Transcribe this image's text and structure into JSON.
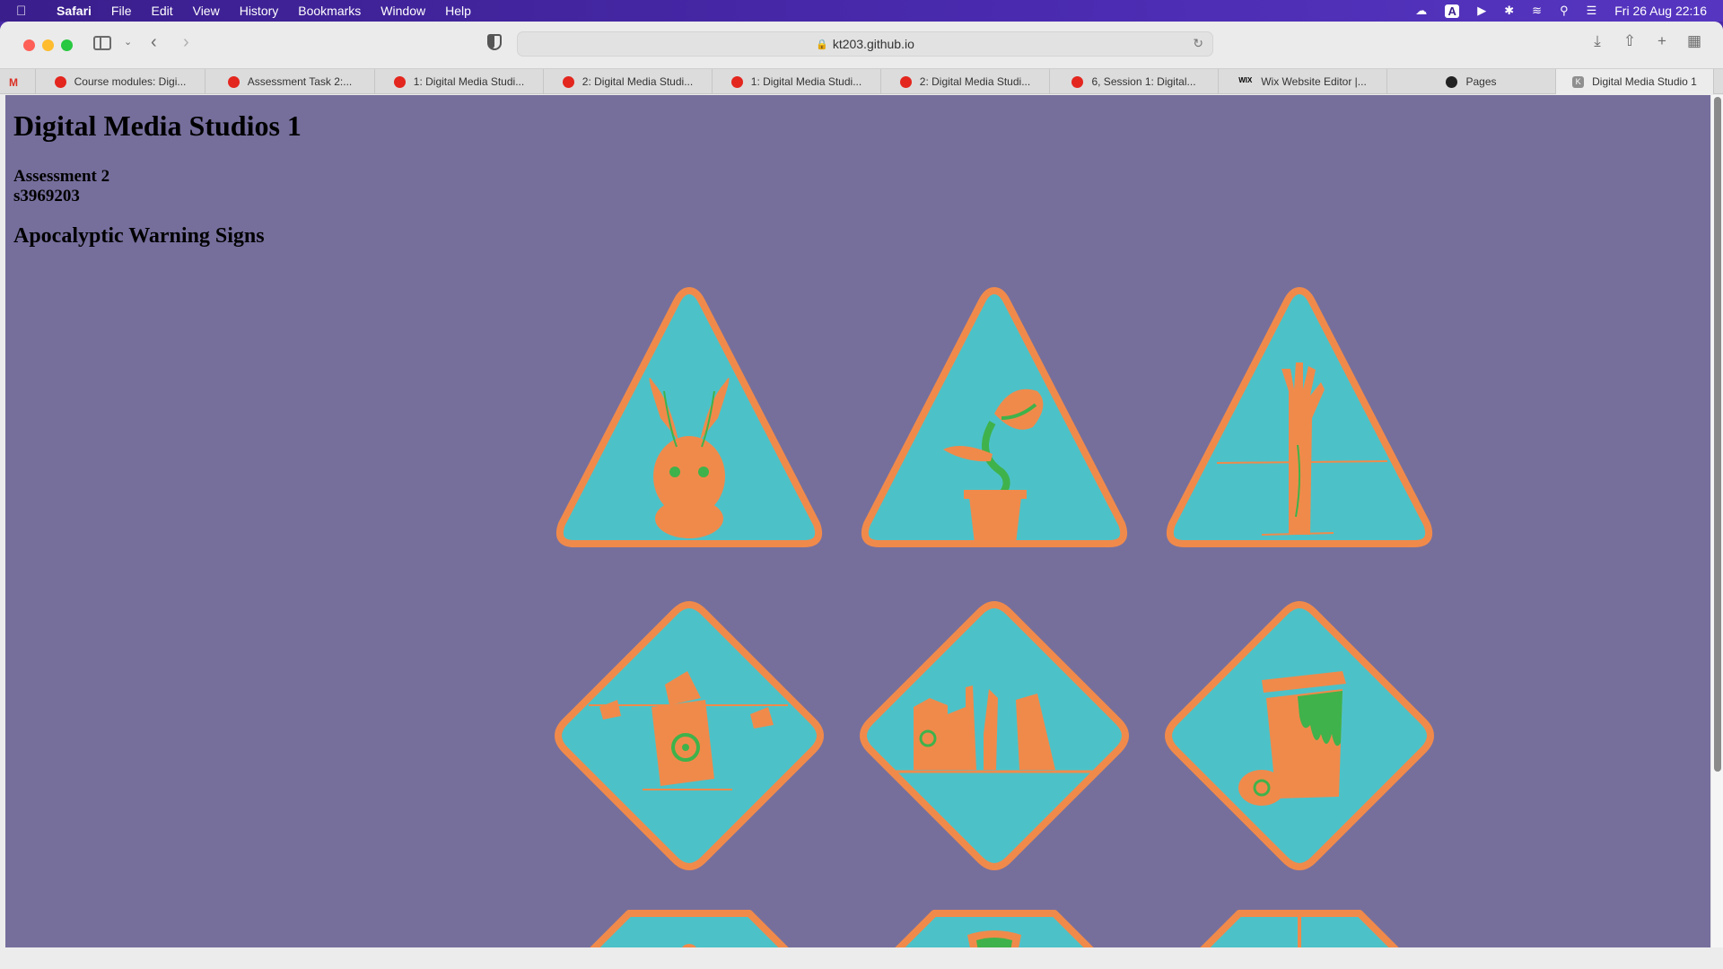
{
  "menubar": {
    "app": "Safari",
    "items": [
      "File",
      "Edit",
      "View",
      "History",
      "Bookmarks",
      "Window",
      "Help"
    ],
    "clock": "Fri 26 Aug  22:16",
    "status_icons": [
      "creative-cloud-icon",
      "input-source-icon",
      "play-icon",
      "bluetooth-icon",
      "wifi-icon",
      "spotlight-icon",
      "control-center-icon"
    ]
  },
  "toolbar": {
    "url": "kt203.github.io"
  },
  "tabs": [
    {
      "label": "",
      "icon": "gmail-icon"
    },
    {
      "label": "Course modules: Digi...",
      "icon": "canvas-icon"
    },
    {
      "label": "Assessment Task 2:...",
      "icon": "canvas-icon"
    },
    {
      "label": "1: Digital Media Studi...",
      "icon": "canvas-icon"
    },
    {
      "label": "2: Digital Media Studi...",
      "icon": "canvas-icon"
    },
    {
      "label": "1: Digital Media Studi...",
      "icon": "canvas-icon"
    },
    {
      "label": "2: Digital Media Studi...",
      "icon": "canvas-icon"
    },
    {
      "label": "6, Session 1: Digital...",
      "icon": "canvas-icon"
    },
    {
      "label": "Wix Website Editor |...",
      "icon": "wix-icon"
    },
    {
      "label": "Pages",
      "icon": "github-icon"
    },
    {
      "label": "Digital Media Studio 1",
      "icon": "k-icon",
      "active": true
    }
  ],
  "page": {
    "title": "Digital Media Studios 1",
    "assessment": "Assessment 2",
    "student_id": "s3969203",
    "subtitle": "Apocalyptic Warning Signs",
    "sign_colors": {
      "fill": "#4cc2c8",
      "border": "#f08a4b",
      "accent": "#3fb24b"
    },
    "signs": [
      {
        "shape": "triangle",
        "icon": "rabbit-icon"
      },
      {
        "shape": "triangle",
        "icon": "carnivorous-plant-icon"
      },
      {
        "shape": "triangle",
        "icon": "zombie-hand-icon"
      },
      {
        "shape": "diamond",
        "icon": "biohazard-barrels-icon"
      },
      {
        "shape": "diamond",
        "icon": "ruined-city-icon"
      },
      {
        "shape": "diamond",
        "icon": "toxic-trash-can-icon"
      },
      {
        "shape": "octagon",
        "icon": "partial-sign-icon"
      },
      {
        "shape": "octagon",
        "icon": "partial-sign-icon"
      },
      {
        "shape": "octagon",
        "icon": "partial-sign-icon"
      }
    ]
  }
}
